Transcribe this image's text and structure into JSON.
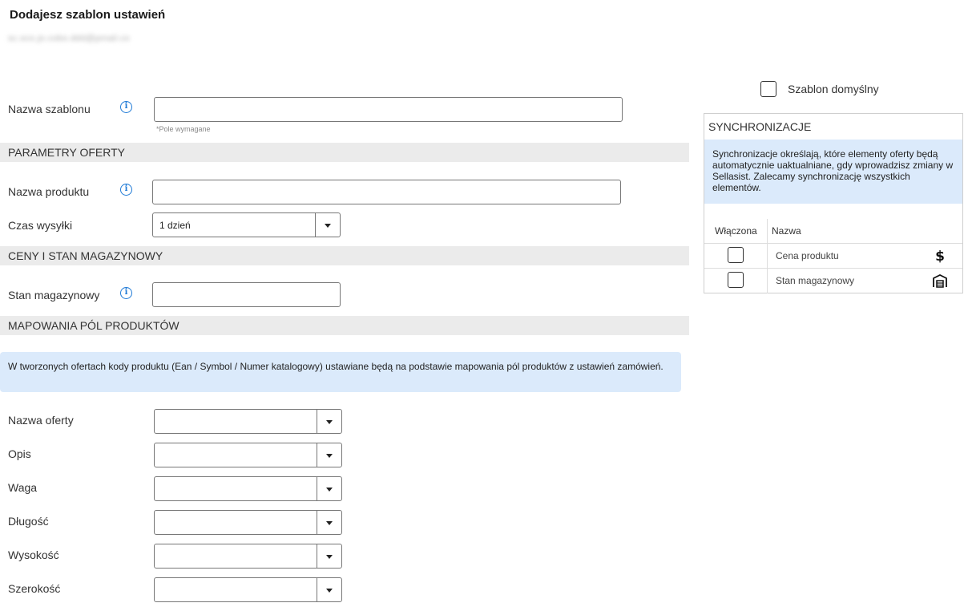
{
  "page": {
    "title": "Dodajesz szablon ustawień",
    "account_blurred": "sc.oco.jo.cobo.ddd@pmail.co"
  },
  "form": {
    "template_name_label": "Nazwa szablonu",
    "template_name_value": "",
    "required_hint": "*Pole wymagane"
  },
  "sections": {
    "offer_params": "PARAMETRY OFERTY",
    "prices_stock": "CENY I STAN MAGAZYNOWY",
    "field_mapping": "MAPOWANIA PÓL PRODUKTÓW"
  },
  "offer": {
    "product_name_label": "Nazwa produktu",
    "product_name_value": "",
    "shipping_time_label": "Czas wysyłki",
    "shipping_time_value": "1 dzień"
  },
  "stock": {
    "stock_label": "Stan magazynowy",
    "stock_value": ""
  },
  "mapping": {
    "notice": "W tworzonych ofertach kody produktu (Ean / Symbol / Numer katalogowy) ustawiane będą na podstawie mapowania pól produktów z ustawień zamówień.",
    "fields": [
      {
        "label": "Nazwa oferty",
        "value": ""
      },
      {
        "label": "Opis",
        "value": ""
      },
      {
        "label": "Waga",
        "value": ""
      },
      {
        "label": "Długość",
        "value": ""
      },
      {
        "label": "Wysokość",
        "value": ""
      },
      {
        "label": "Szerokość",
        "value": ""
      }
    ]
  },
  "sidebar": {
    "default_template_label": "Szablon domyślny",
    "default_template_checked": false,
    "sync": {
      "header": "SYNCHRONIZACJE",
      "notice": "Synchronizacje określają, które elementy oferty będą automatycznie uaktualniane, gdy wprowadzisz zmiany w Sellasist. Zalecamy synchronizację wszystkich elementów.",
      "col_enabled": "Włączona",
      "col_name": "Nazwa",
      "rows": [
        {
          "name": "Cena produktu",
          "icon": "dollar-icon",
          "enabled": false
        },
        {
          "name": "Stan magazynowy",
          "icon": "warehouse-icon",
          "enabled": false
        }
      ]
    }
  },
  "colors": {
    "accent": "#1f7ad6",
    "notice_bg": "#dbeafb",
    "section_bg": "#ebebeb"
  }
}
